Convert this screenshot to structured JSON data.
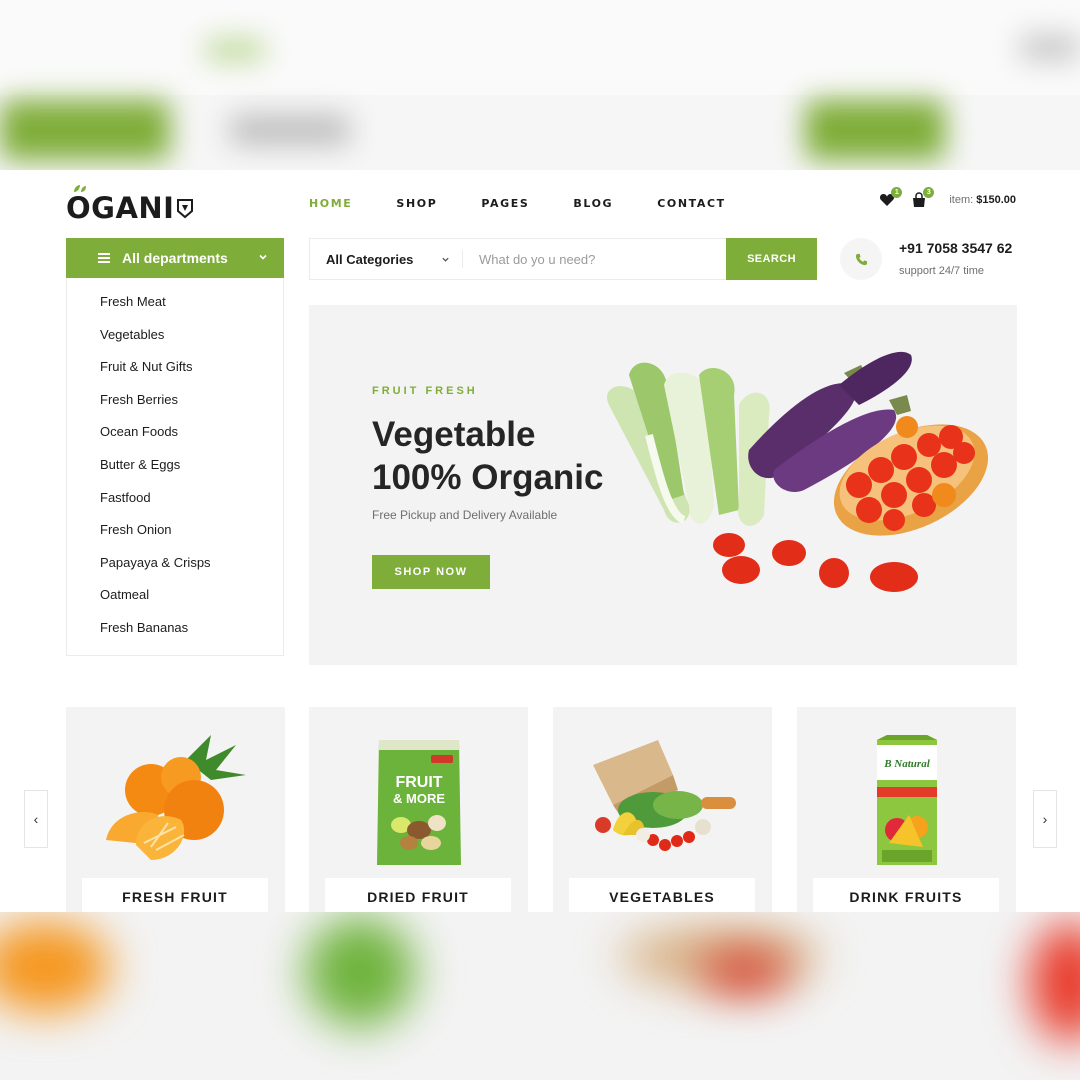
{
  "brand": {
    "name": "OGANI"
  },
  "nav": {
    "items": [
      "HOME",
      "SHOP",
      "PAGES",
      "BLOG",
      "CONTACT"
    ]
  },
  "header": {
    "wishlist_count": "1",
    "cart_count": "3",
    "item_label": "item:",
    "item_total": "$150.00"
  },
  "departments": {
    "button_label": "All departments",
    "items": [
      "Fresh Meat",
      "Vegetables",
      "Fruit & Nut Gifts",
      "Fresh Berries",
      "Ocean Foods",
      "Butter & Eggs",
      "Fastfood",
      "Fresh Onion",
      "Papayaya & Crisps",
      "Oatmeal",
      "Fresh Bananas"
    ]
  },
  "search": {
    "category_label": "All Categories",
    "placeholder": "What do yo u need?",
    "button_label": "SEARCH"
  },
  "contact": {
    "phone": "+91 7058 3547 62",
    "support": "support 24/7 time"
  },
  "hero": {
    "kicker": "FRUIT FRESH",
    "title_line1": "Vegetable",
    "title_line2": "100% Organic",
    "subtitle": "Free Pickup and Delivery Available",
    "cta": "SHOP NOW"
  },
  "categories": [
    {
      "label": "FRESH FRUIT"
    },
    {
      "label": "DRIED FRUIT"
    },
    {
      "label": "VEGETABLES"
    },
    {
      "label": "DRINK FRUITS"
    }
  ],
  "product_art": {
    "dried_bag_text1": "FRUIT",
    "dried_bag_text2": "& MORE",
    "juice_brand": "B Natural"
  },
  "colors": {
    "accent": "#7fad39",
    "text": "#1c1c1c",
    "muted": "#6f6f6f",
    "panel": "#f3f3f3"
  }
}
